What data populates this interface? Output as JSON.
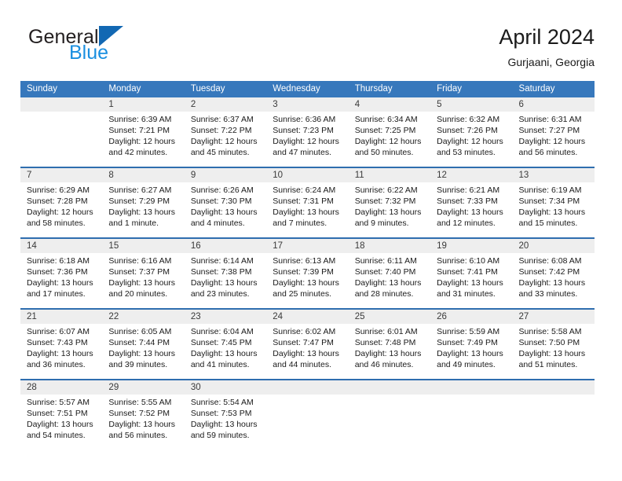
{
  "brand": {
    "general": "General",
    "blue": "Blue",
    "triangle_color": "#1268b3",
    "blue_color": "#1a8fe0"
  },
  "header": {
    "month_title": "April 2024",
    "location": "Gurjaani, Georgia"
  },
  "theme": {
    "header_bg": "#3778bc",
    "week_divider": "#2f6eaf",
    "day_number_bg": "#eeeeee",
    "text": "#1a1a1a"
  },
  "weekdays": [
    "Sunday",
    "Monday",
    "Tuesday",
    "Wednesday",
    "Thursday",
    "Friday",
    "Saturday"
  ],
  "weeks": [
    [
      {
        "day": "",
        "lines": []
      },
      {
        "day": "1",
        "lines": [
          "Sunrise: 6:39 AM",
          "Sunset: 7:21 PM",
          "Daylight: 12 hours",
          "and 42 minutes."
        ]
      },
      {
        "day": "2",
        "lines": [
          "Sunrise: 6:37 AM",
          "Sunset: 7:22 PM",
          "Daylight: 12 hours",
          "and 45 minutes."
        ]
      },
      {
        "day": "3",
        "lines": [
          "Sunrise: 6:36 AM",
          "Sunset: 7:23 PM",
          "Daylight: 12 hours",
          "and 47 minutes."
        ]
      },
      {
        "day": "4",
        "lines": [
          "Sunrise: 6:34 AM",
          "Sunset: 7:25 PM",
          "Daylight: 12 hours",
          "and 50 minutes."
        ]
      },
      {
        "day": "5",
        "lines": [
          "Sunrise: 6:32 AM",
          "Sunset: 7:26 PM",
          "Daylight: 12 hours",
          "and 53 minutes."
        ]
      },
      {
        "day": "6",
        "lines": [
          "Sunrise: 6:31 AM",
          "Sunset: 7:27 PM",
          "Daylight: 12 hours",
          "and 56 minutes."
        ]
      }
    ],
    [
      {
        "day": "7",
        "lines": [
          "Sunrise: 6:29 AM",
          "Sunset: 7:28 PM",
          "Daylight: 12 hours",
          "and 58 minutes."
        ]
      },
      {
        "day": "8",
        "lines": [
          "Sunrise: 6:27 AM",
          "Sunset: 7:29 PM",
          "Daylight: 13 hours",
          "and 1 minute."
        ]
      },
      {
        "day": "9",
        "lines": [
          "Sunrise: 6:26 AM",
          "Sunset: 7:30 PM",
          "Daylight: 13 hours",
          "and 4 minutes."
        ]
      },
      {
        "day": "10",
        "lines": [
          "Sunrise: 6:24 AM",
          "Sunset: 7:31 PM",
          "Daylight: 13 hours",
          "and 7 minutes."
        ]
      },
      {
        "day": "11",
        "lines": [
          "Sunrise: 6:22 AM",
          "Sunset: 7:32 PM",
          "Daylight: 13 hours",
          "and 9 minutes."
        ]
      },
      {
        "day": "12",
        "lines": [
          "Sunrise: 6:21 AM",
          "Sunset: 7:33 PM",
          "Daylight: 13 hours",
          "and 12 minutes."
        ]
      },
      {
        "day": "13",
        "lines": [
          "Sunrise: 6:19 AM",
          "Sunset: 7:34 PM",
          "Daylight: 13 hours",
          "and 15 minutes."
        ]
      }
    ],
    [
      {
        "day": "14",
        "lines": [
          "Sunrise: 6:18 AM",
          "Sunset: 7:36 PM",
          "Daylight: 13 hours",
          "and 17 minutes."
        ]
      },
      {
        "day": "15",
        "lines": [
          "Sunrise: 6:16 AM",
          "Sunset: 7:37 PM",
          "Daylight: 13 hours",
          "and 20 minutes."
        ]
      },
      {
        "day": "16",
        "lines": [
          "Sunrise: 6:14 AM",
          "Sunset: 7:38 PM",
          "Daylight: 13 hours",
          "and 23 minutes."
        ]
      },
      {
        "day": "17",
        "lines": [
          "Sunrise: 6:13 AM",
          "Sunset: 7:39 PM",
          "Daylight: 13 hours",
          "and 25 minutes."
        ]
      },
      {
        "day": "18",
        "lines": [
          "Sunrise: 6:11 AM",
          "Sunset: 7:40 PM",
          "Daylight: 13 hours",
          "and 28 minutes."
        ]
      },
      {
        "day": "19",
        "lines": [
          "Sunrise: 6:10 AM",
          "Sunset: 7:41 PM",
          "Daylight: 13 hours",
          "and 31 minutes."
        ]
      },
      {
        "day": "20",
        "lines": [
          "Sunrise: 6:08 AM",
          "Sunset: 7:42 PM",
          "Daylight: 13 hours",
          "and 33 minutes."
        ]
      }
    ],
    [
      {
        "day": "21",
        "lines": [
          "Sunrise: 6:07 AM",
          "Sunset: 7:43 PM",
          "Daylight: 13 hours",
          "and 36 minutes."
        ]
      },
      {
        "day": "22",
        "lines": [
          "Sunrise: 6:05 AM",
          "Sunset: 7:44 PM",
          "Daylight: 13 hours",
          "and 39 minutes."
        ]
      },
      {
        "day": "23",
        "lines": [
          "Sunrise: 6:04 AM",
          "Sunset: 7:45 PM",
          "Daylight: 13 hours",
          "and 41 minutes."
        ]
      },
      {
        "day": "24",
        "lines": [
          "Sunrise: 6:02 AM",
          "Sunset: 7:47 PM",
          "Daylight: 13 hours",
          "and 44 minutes."
        ]
      },
      {
        "day": "25",
        "lines": [
          "Sunrise: 6:01 AM",
          "Sunset: 7:48 PM",
          "Daylight: 13 hours",
          "and 46 minutes."
        ]
      },
      {
        "day": "26",
        "lines": [
          "Sunrise: 5:59 AM",
          "Sunset: 7:49 PM",
          "Daylight: 13 hours",
          "and 49 minutes."
        ]
      },
      {
        "day": "27",
        "lines": [
          "Sunrise: 5:58 AM",
          "Sunset: 7:50 PM",
          "Daylight: 13 hours",
          "and 51 minutes."
        ]
      }
    ],
    [
      {
        "day": "28",
        "lines": [
          "Sunrise: 5:57 AM",
          "Sunset: 7:51 PM",
          "Daylight: 13 hours",
          "and 54 minutes."
        ]
      },
      {
        "day": "29",
        "lines": [
          "Sunrise: 5:55 AM",
          "Sunset: 7:52 PM",
          "Daylight: 13 hours",
          "and 56 minutes."
        ]
      },
      {
        "day": "30",
        "lines": [
          "Sunrise: 5:54 AM",
          "Sunset: 7:53 PM",
          "Daylight: 13 hours",
          "and 59 minutes."
        ]
      },
      {
        "day": "",
        "lines": []
      },
      {
        "day": "",
        "lines": []
      },
      {
        "day": "",
        "lines": []
      },
      {
        "day": "",
        "lines": []
      }
    ]
  ]
}
